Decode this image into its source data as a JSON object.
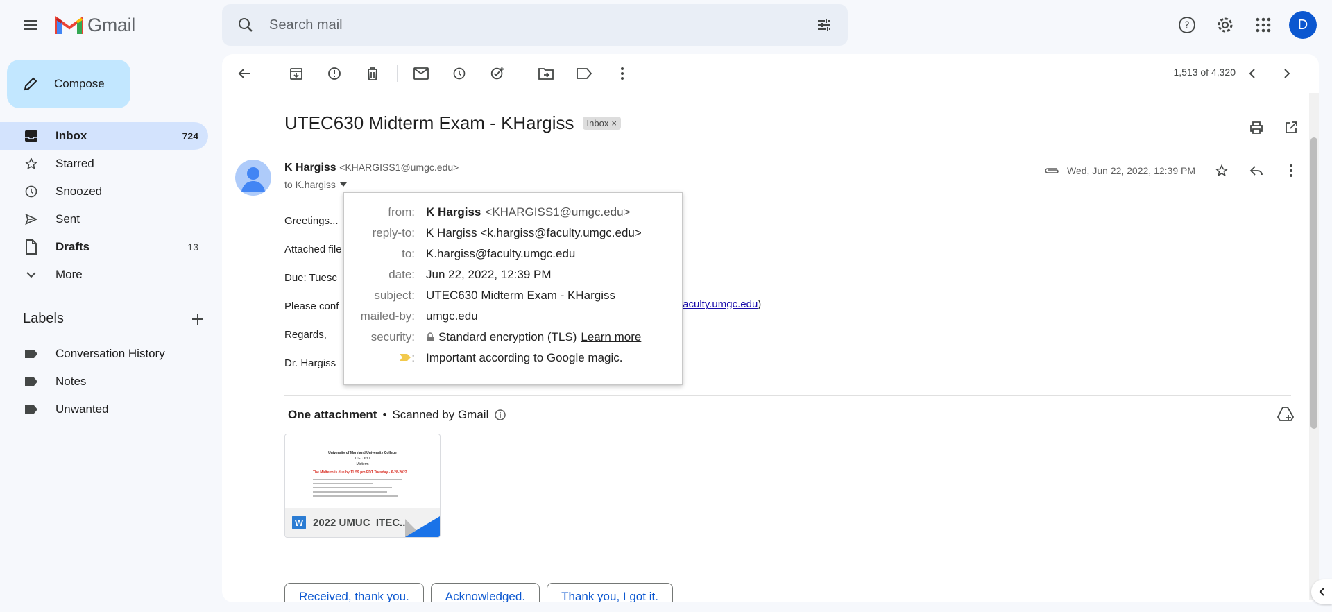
{
  "app": {
    "name": "Gmail",
    "avatar_letter": "D"
  },
  "search": {
    "placeholder": "Search mail"
  },
  "sidebar": {
    "compose": "Compose",
    "items": [
      {
        "label": "Inbox",
        "count": "724",
        "icon": "inbox-icon"
      },
      {
        "label": "Starred",
        "count": "",
        "icon": "star-icon"
      },
      {
        "label": "Snoozed",
        "count": "",
        "icon": "clock-icon"
      },
      {
        "label": "Sent",
        "count": "",
        "icon": "send-icon"
      },
      {
        "label": "Drafts",
        "count": "13",
        "icon": "file-icon"
      },
      {
        "label": "More",
        "count": "",
        "icon": "chevron-down-icon"
      }
    ],
    "labels_title": "Labels",
    "labels": [
      "Conversation History",
      "Notes",
      "Unwanted"
    ]
  },
  "toolbar": {
    "pager": "1,513 of 4,320"
  },
  "message": {
    "subject": "UTEC630 Midterm Exam - KHargiss",
    "badge": "Inbox",
    "sender_name": "K Hargiss",
    "sender_email": "<KHARGISS1@umgc.edu>",
    "to": "to K.hargiss",
    "date": "Wed, Jun 22, 2022, 12:39 PM",
    "body": [
      "Greetings...",
      "Attached file",
      "Due:  Tuesc",
      "Please conf",
      "Regards,",
      "Dr. Hargiss"
    ],
    "body_link_fragment": "faculty.umgc.edu",
    "body_link_close": ")"
  },
  "details_popup": {
    "from_label": "from:",
    "from_name": "K Hargiss",
    "from_email": "<KHARGISS1@umgc.edu>",
    "reply_to_label": "reply-to:",
    "reply_to": "K Hargiss <k.hargiss@faculty.umgc.edu>",
    "to_label": "to:",
    "to": "K.hargiss@faculty.umgc.edu",
    "date_label": "date:",
    "date": "Jun 22, 2022, 12:39 PM",
    "subject_label": "subject:",
    "subject": "UTEC630 Midterm Exam - KHargiss",
    "mailed_by_label": "mailed-by:",
    "mailed_by": "umgc.edu",
    "security_label": "security:",
    "security": "Standard encryption (TLS)",
    "learn_more": "Learn more",
    "importance_label": ":",
    "importance": "Important according to Google magic."
  },
  "attachments": {
    "heading": "One attachment",
    "scanned": "Scanned by Gmail",
    "file_name": "2022 UMUC_ITEC...",
    "thumb_lines": [
      "University of Maryland University College",
      "ITEC 630",
      "Midterm",
      "The Midterm is due by 11:59 pm EDT Tuesday - 6-28-2022"
    ]
  },
  "smart_replies": [
    "Received, thank you.",
    "Acknowledged.",
    "Thank you, I got it."
  ],
  "colors": {
    "accent": "#0b57d0",
    "compose_bg": "#c2e7ff",
    "active_nav": "#d3e3fd",
    "panel_bg": "#f6f8fc"
  }
}
